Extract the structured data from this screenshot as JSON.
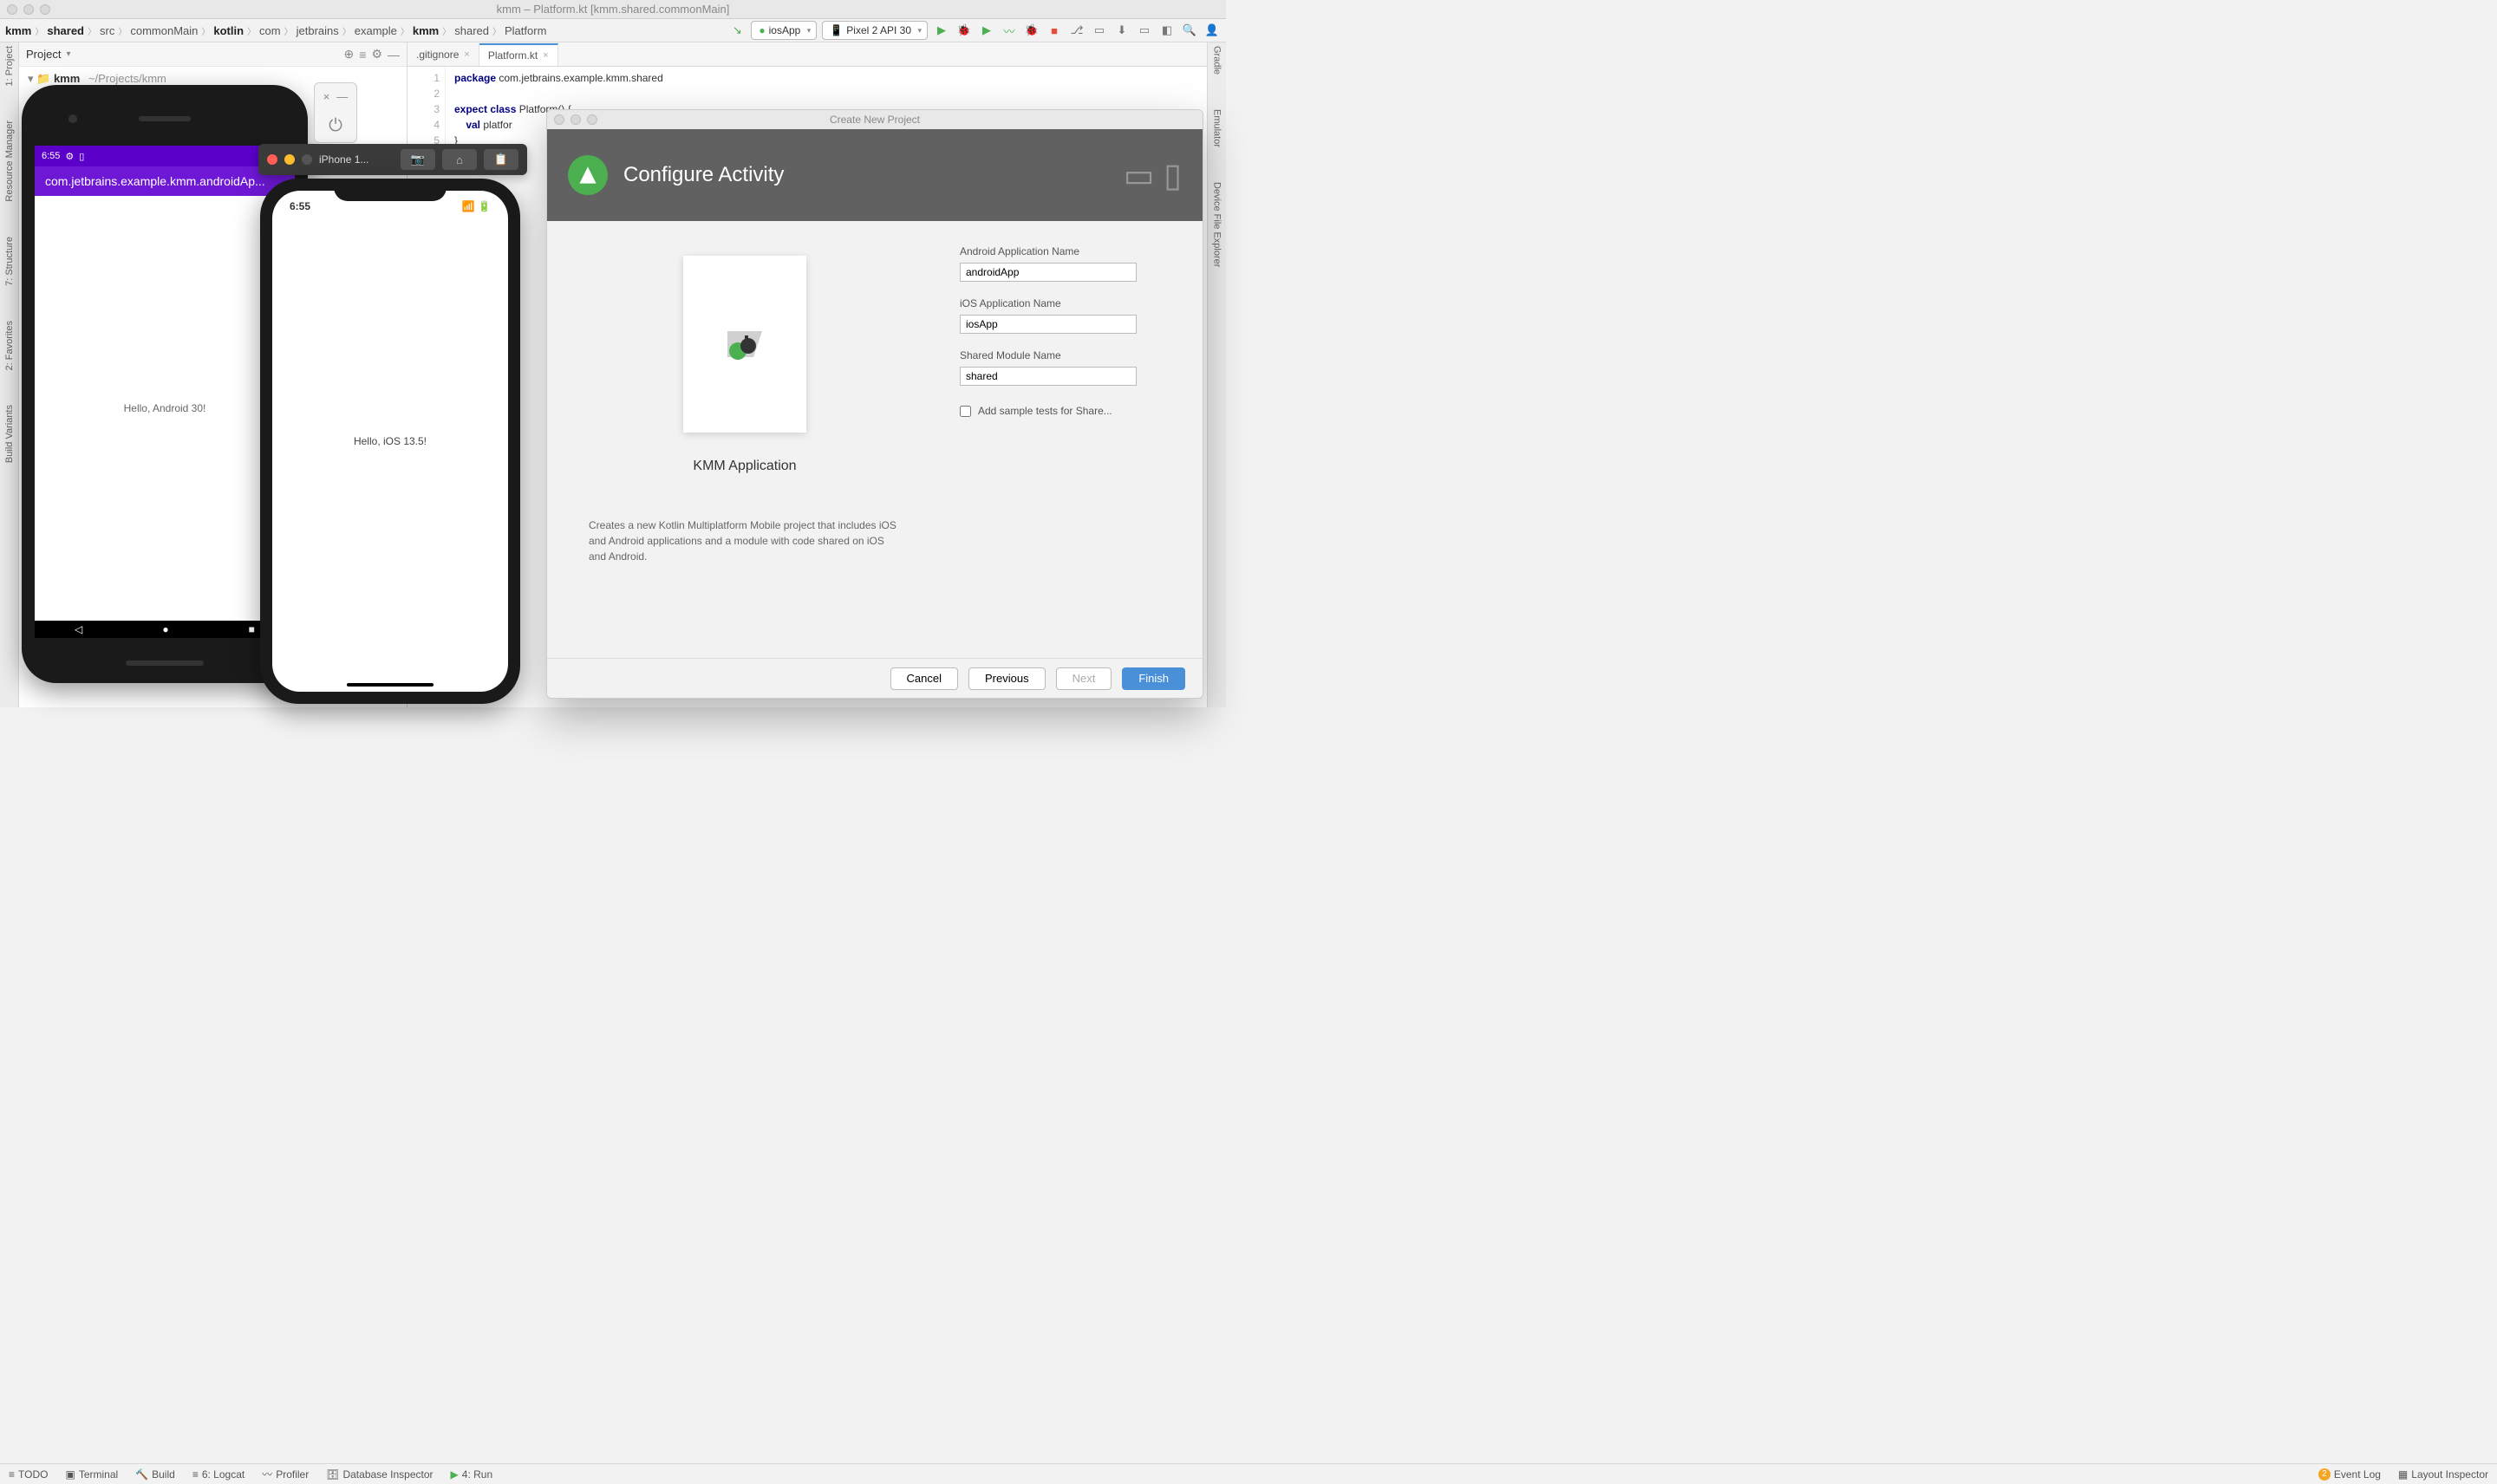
{
  "window": {
    "title": "kmm – Platform.kt [kmm.shared.commonMain]"
  },
  "breadcrumb": [
    "kmm",
    "shared",
    "src",
    "commonMain",
    "kotlin",
    "com",
    "jetbrains",
    "example",
    "kmm",
    "shared",
    "Platform"
  ],
  "run_config": "iosApp",
  "device": "Pixel 2 API 30",
  "project_panel": {
    "title": "Project",
    "root_name": "kmm",
    "root_path": "~/Projects/kmm"
  },
  "tabs": [
    {
      "label": ".gitignore",
      "active": false
    },
    {
      "label": "Platform.kt",
      "active": true
    }
  ],
  "code": {
    "lines": [
      "1",
      "2",
      "3",
      "4",
      "5"
    ],
    "l1_kw": "package",
    "l1_rest": " com.jetbrains.example.kmm.shared",
    "l3_a": "expect ",
    "l3_b": "class ",
    "l3_c": "Platform() {",
    "l4_a": "    val ",
    "l4_b": "platfor",
    "l5": "}"
  },
  "status_items": {
    "todo": "TODO",
    "terminal": "Terminal",
    "build": "Build",
    "logcat": "6: Logcat",
    "profiler": "Profiler",
    "db": "Database Inspector",
    "run": "4: Run",
    "eventlog": "Event Log",
    "eventlog_count": "2",
    "layout": "Layout Inspector"
  },
  "left_strip": [
    "1: Project",
    "Resource Manager",
    "7: Structure",
    "2: Favorites",
    "Build Variants"
  ],
  "right_strip": [
    "Gradle",
    "Emulator",
    "Device File Explorer"
  ],
  "android": {
    "time": "6:55",
    "app_title": "com.jetbrains.example.kmm.androidAp...",
    "body_text": "Hello, Android 30!"
  },
  "ios_toolbar": {
    "label": "iPhone 1...",
    "home": "⌂"
  },
  "iphone": {
    "time": "6:55",
    "body_text": "Hello, iOS 13.5!"
  },
  "dialog": {
    "title": "Create New Project",
    "hero": "Configure Activity",
    "preview_title": "KMM Application",
    "preview_desc": "Creates a new Kotlin Multiplatform Mobile project that includes iOS and Android applications and a module with code shared on iOS and Android.",
    "fields": {
      "android_label": "Android Application Name",
      "android_value": "androidApp",
      "ios_label": "iOS Application Name",
      "ios_value": "iosApp",
      "shared_label": "Shared Module Name",
      "shared_value": "shared",
      "checkbox_label": "Add sample tests for Share..."
    },
    "buttons": {
      "cancel": "Cancel",
      "previous": "Previous",
      "next": "Next",
      "finish": "Finish"
    }
  }
}
